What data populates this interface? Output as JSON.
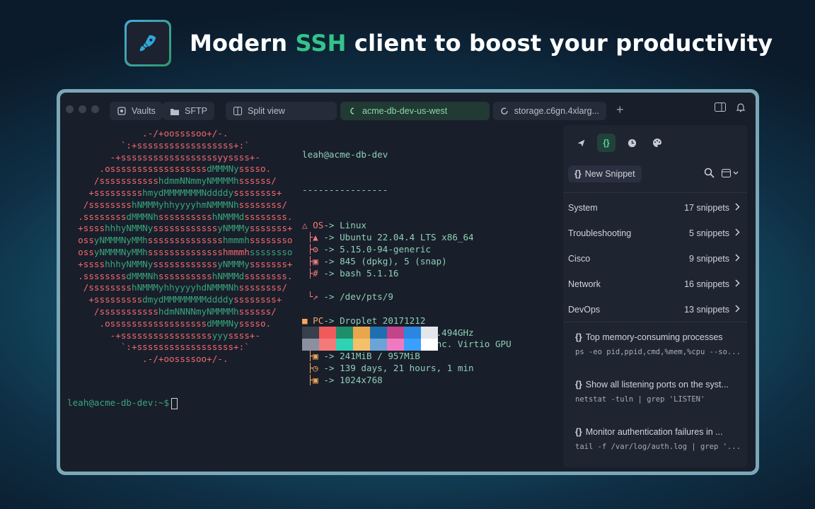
{
  "headline": {
    "pre": "Modern ",
    "accent": "SSH",
    "post": " client to boost your productivity"
  },
  "icons": {
    "logo": "rocket-icon"
  },
  "tabs": [
    {
      "label": "Vaults",
      "icon": "vault-icon"
    },
    {
      "label": "SFTP",
      "icon": "folder-icon"
    },
    {
      "label": "Split view",
      "icon": "split-icon"
    },
    {
      "label": "acme-db-dev-us-west",
      "icon": "host-icon",
      "active": true
    },
    {
      "label": "storage.c6gn.4xlarg...",
      "icon": "spinner-icon"
    }
  ],
  "terminal": {
    "header": "leah@acme-db-dev",
    "underline": "----------------",
    "rows": [
      {
        "key": "OS",
        "val": "-> Linux"
      },
      {
        "key": "",
        "val": "-> Ubuntu 22.04.4 LTS x86_64"
      },
      {
        "key": "",
        "val": "-> 5.15.0-94-generic"
      },
      {
        "key": "",
        "val": "-> 845 (dpkg), 5 (snap)"
      },
      {
        "key": "",
        "val": "-> bash 5.1.16"
      },
      {
        "key": "",
        "val": "-> /dev/pts/9"
      },
      {
        "key": "PC",
        "val": "-> Droplet 20171212"
      },
      {
        "key": "",
        "val": "-> DO-Regular (1) @ 2.494GHz"
      },
      {
        "key": "",
        "val": "-> 00:02.0 Red Hat, Inc. Virtio GPU"
      },
      {
        "key": "",
        "val": "-> 241MiB / 957MiB"
      },
      {
        "key": "",
        "val": "-> 139 days, 21 hours, 1 min"
      },
      {
        "key": "",
        "val": "-> 1024x768"
      }
    ],
    "art": [
      [
        "              .-/+oossssoo+/-.",
        ""
      ],
      [
        "          `:+ssssssssssssssssss+:`",
        ""
      ],
      [
        "        -+ssssssssssssssssssyyssss+-",
        ""
      ],
      [
        "      .ossssssssssssssssss",
        "dMMMNy",
        "sssso."
      ],
      [
        "     /sssssssssss",
        "hdmmNNmmyNMMMMh",
        "ssssss/"
      ],
      [
        "    +sssssssss",
        "hmydMMMMMMMNddddy",
        "ssssssss+"
      ],
      [
        "   /ssssssss",
        "hNMMMyhhyyyyhmNMMMNh",
        "ssssssss/"
      ],
      [
        "  .ssssssss",
        "dMMMNh",
        "ssssssssss",
        "hNMMMd",
        "ssssssss."
      ],
      [
        "  +ssss",
        "hhhyNMMNy",
        "ssssssssssss",
        "yNMMMy",
        "sssssss+"
      ],
      [
        "  oss",
        "yNMMMNyMMh",
        "ssssssssssssss",
        "hmmmh",
        "ssssssso"
      ],
      [
        "  oss",
        "yNMMMNyMMh",
        "sssssssssssssshmmmh",
        "ssssssso"
      ],
      [
        "  +ssss",
        "hhhyNMMNy",
        "ssssssssssss",
        "yNMMMy",
        "sssssss+"
      ],
      [
        "  .ssssssss",
        "dMMMNh",
        "ssssssssss",
        "hNMMMd",
        "ssssssss."
      ],
      [
        "   /ssssssss",
        "hNMMMyhhyyyyhdNMMMNh",
        "ssssssss/"
      ],
      [
        "    +sssssssss",
        "dmydMMMMMMMMddddy",
        "ssssssss+"
      ],
      [
        "     /sssssssssss",
        "hdmNNNNmyNMMMMh",
        "ssssss/"
      ],
      [
        "      .ossssssssssssssssss",
        "dMMMNy",
        "sssso."
      ],
      [
        "        -+sssssssssssssssss",
        "yyy",
        "ssss+-"
      ],
      [
        "          `:+ssssssssssssssssss+:`",
        ""
      ],
      [
        "              .-/+oossssoo+/-.",
        ""
      ]
    ],
    "palette_top": [
      "#3a3f4d",
      "#f05a5a",
      "#1f8f6a",
      "#e8a74a",
      "#1f6fb0",
      "#c2448a",
      "#2b86e0",
      "#e3e6ea"
    ],
    "palette_bottom": [
      "#8a90a0",
      "#f47a7a",
      "#2fd3b4",
      "#f4c06a",
      "#6aa4d8",
      "#f07ac0",
      "#3aa0ff",
      "#ffffff"
    ],
    "prompt": "leah@acme-db-dev:~$"
  },
  "panel": {
    "tools": [
      "rocket-icon",
      "{}",
      "history-icon",
      "palette-icon"
    ],
    "new_snippet": "New Snippet",
    "categories": [
      {
        "name": "System",
        "count": "17 snippets"
      },
      {
        "name": "Troubleshooting",
        "count": "5 snippets"
      },
      {
        "name": "Cisco",
        "count": "9 snippets"
      },
      {
        "name": "Network",
        "count": "16 snippets"
      },
      {
        "name": "DevOps",
        "count": "13 snippets"
      }
    ],
    "snippets": [
      {
        "title": "Top memory-consuming processes",
        "cmd": "ps -eo pid,ppid,cmd,%mem,%cpu --so..."
      },
      {
        "title": "Show all listening ports on the syst...",
        "cmd": "netstat -tuln | grep 'LISTEN'"
      },
      {
        "title": "Monitor authentication failures in ...",
        "cmd": "tail -f /var/log/auth.log | grep '..."
      }
    ]
  }
}
